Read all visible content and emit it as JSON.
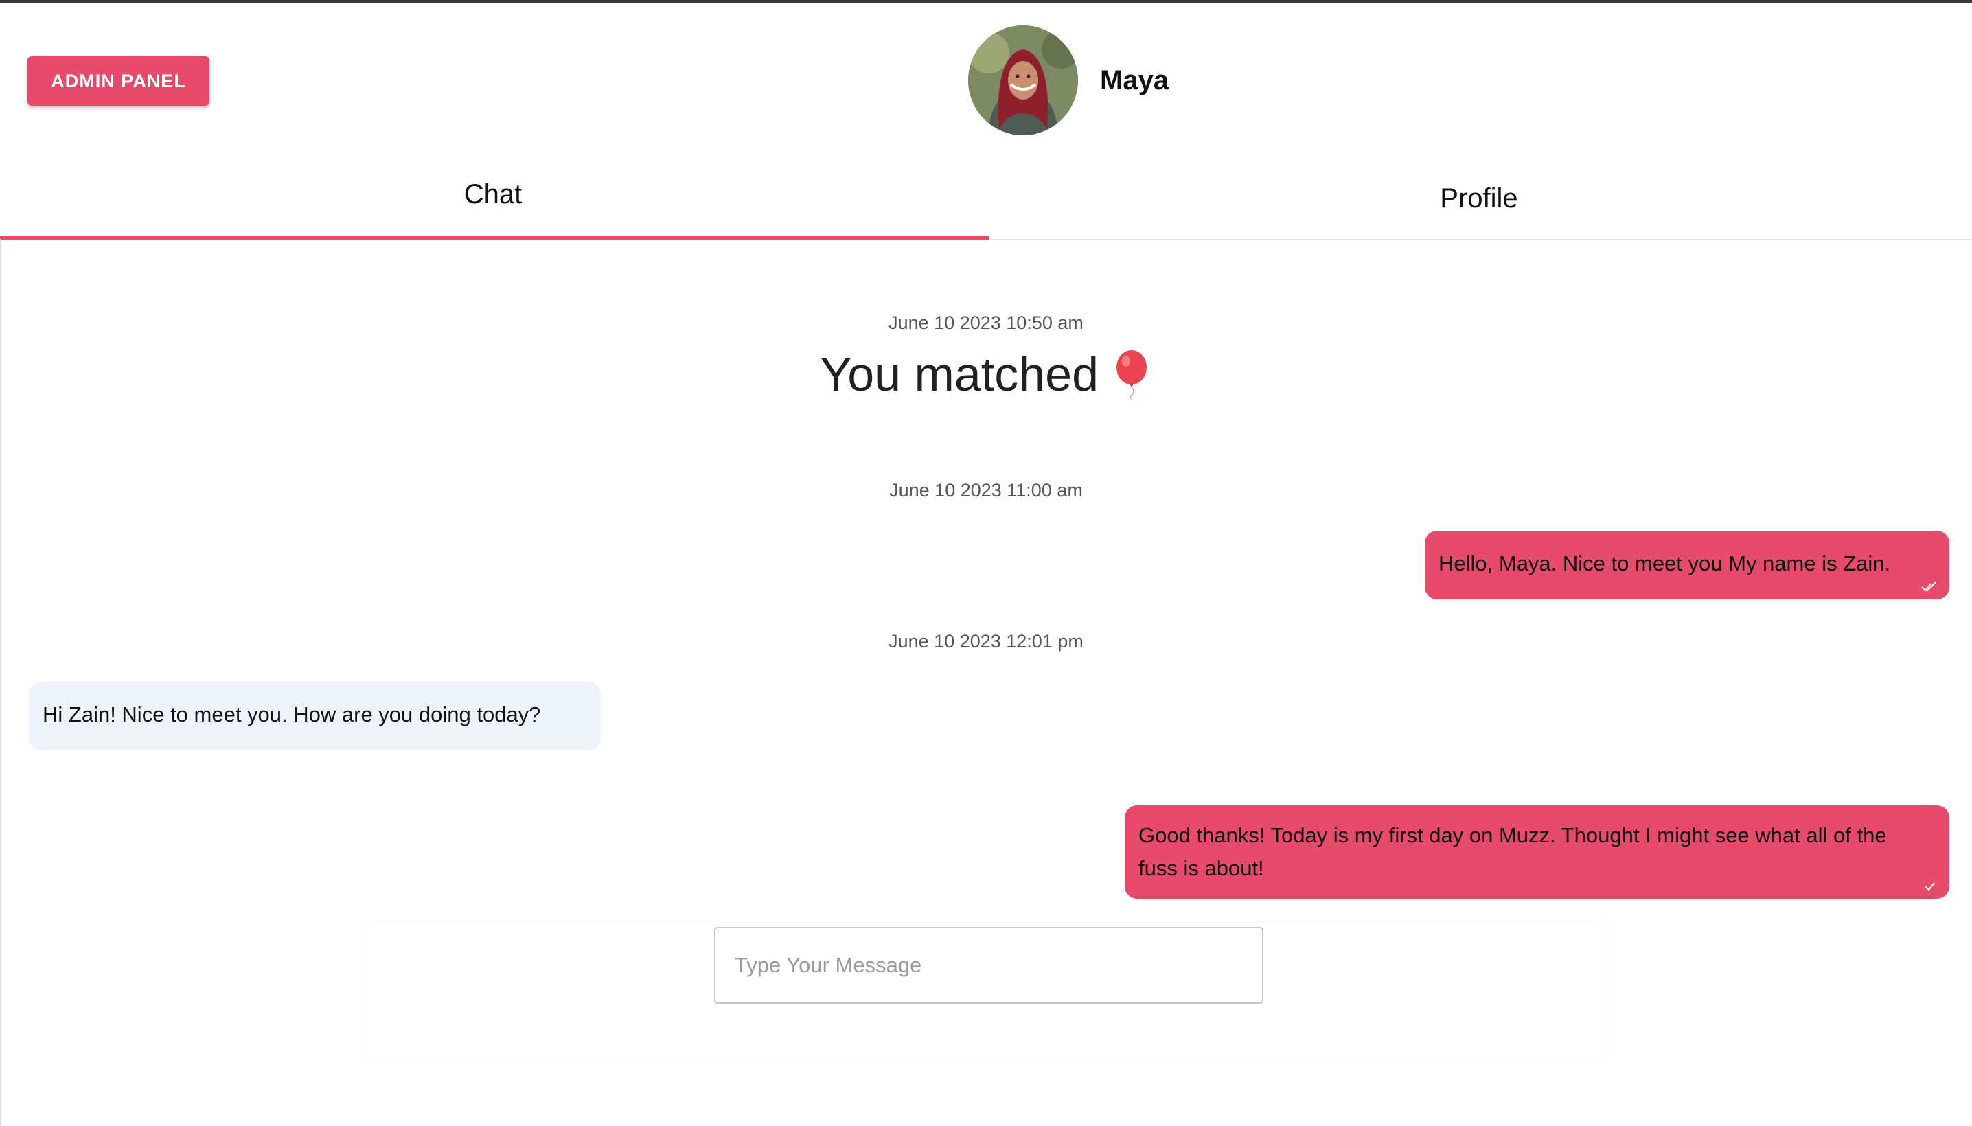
{
  "header": {
    "admin_button_label": "ADMIN PANEL",
    "user_name": "Maya",
    "avatar_icon": "profile-photo"
  },
  "tabs": [
    {
      "label": "Chat",
      "active": true
    },
    {
      "label": "Profile",
      "active": false
    }
  ],
  "chat": {
    "match_timestamp": "June 10 2023 10:50 am",
    "match_text": "You matched",
    "match_icon": "balloon-icon",
    "messages": [
      {
        "timestamp": "June 10 2023 11:00 am",
        "direction": "sent",
        "text": "Hello, Maya. Nice to meet you My name is Zain.",
        "status_icon": "double-check-icon"
      },
      {
        "timestamp": "June 10 2023 12:01 pm",
        "direction": "received",
        "text": "Hi Zain! Nice to meet you. How are you doing today?"
      },
      {
        "direction": "sent",
        "text": "Good thanks! Today is my first day on Muzz. Thought I might see what all of the fuss is about!",
        "status_icon": "check-icon"
      }
    ]
  },
  "composer": {
    "placeholder": "Type Your Message",
    "value": ""
  },
  "colors": {
    "accent": "#e64b6b",
    "received_bubble": "#eef2f9",
    "tab_underline": "#e64b6b"
  }
}
